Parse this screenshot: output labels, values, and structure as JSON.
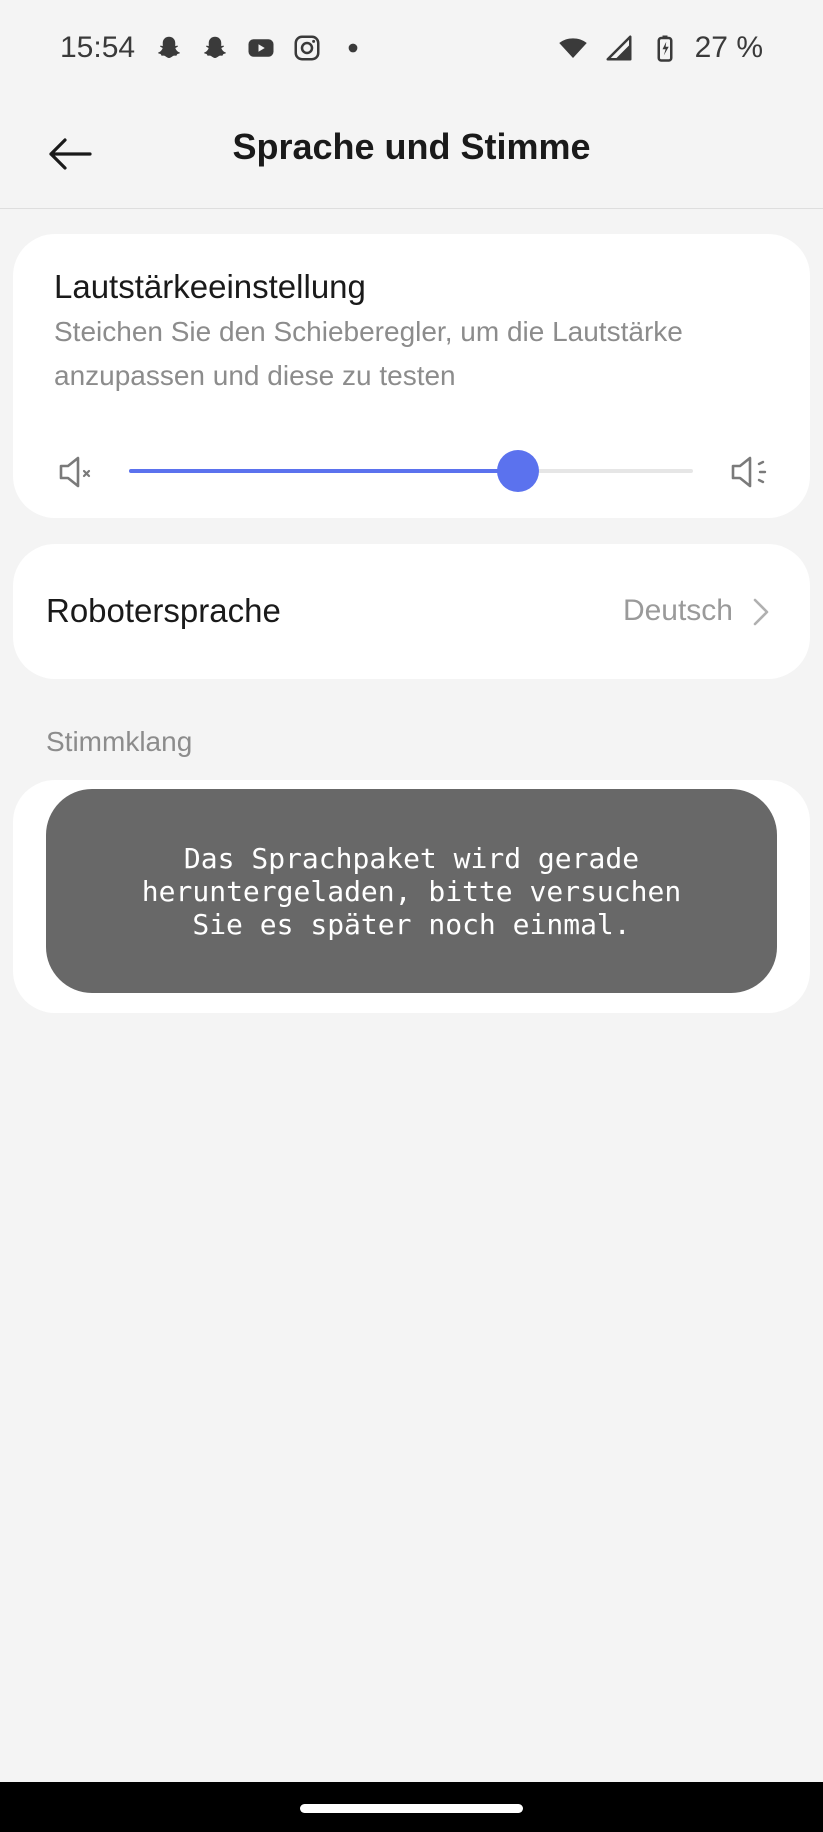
{
  "status_bar": {
    "time": "15:54",
    "battery": "27 %",
    "left_icons": [
      "snapchat-icon",
      "snapchat-icon",
      "youtube-icon",
      "instagram-icon",
      "dot-icon"
    ],
    "right_icons": [
      "wifi-icon",
      "signal-icon",
      "battery-charging-icon"
    ]
  },
  "header": {
    "title": "Sprache und Stimme",
    "back_icon": "arrow-left-icon"
  },
  "volume": {
    "title": "Lautstärkeeinstellung",
    "description": "Steichen Sie den Schieberegler, um die Lautstärke anzupassen und diese zu testen",
    "level": 0.69,
    "accent_color": "#5b72ee",
    "min_icon": "volume-mute-icon",
    "max_icon": "volume-high-icon"
  },
  "robot_language": {
    "label": "Robotersprache",
    "value": "Deutsch",
    "chevron_icon": "chevron-right-icon"
  },
  "voice_section": {
    "label": "Stimmklang"
  },
  "toast": {
    "message": "Das Sprachpaket wird gerade\nheruntergeladen, bitte versuchen\nSie es später noch einmal."
  }
}
